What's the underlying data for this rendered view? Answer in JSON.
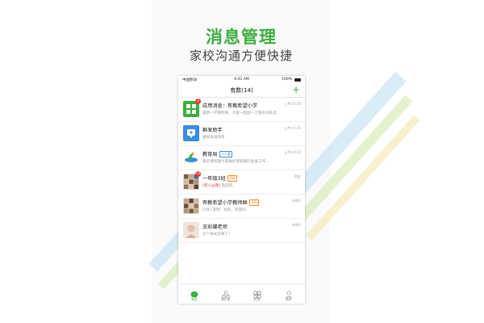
{
  "banner": {
    "headline": "消息管理",
    "subline": "家校沟通方便快捷"
  },
  "status_bar": {
    "carrier": "中国移动",
    "time": "9:41 AM",
    "battery": "100%"
  },
  "nav": {
    "title": "有数(14)",
    "add_label": "+"
  },
  "conversations": [
    {
      "name": "应用消息：有教希望小学",
      "preview": "最新一学期到来，大家一起给一江春水的私流",
      "time": "上午10:30",
      "badge": "2",
      "avatar": "app-grid-icon"
    },
    {
      "name": "群发助手",
      "preview": "通知发送简单",
      "time": "上午10:30",
      "badge": "",
      "avatar": "broadcast-icon"
    },
    {
      "name": "教育局",
      "tag": "人人通",
      "preview": "临近寒假期大家做好寒假期的准备工作...",
      "time": "上午10:30",
      "badge": "",
      "avatar": "education-logo"
    },
    {
      "name": "一年级3班",
      "tag": "班级",
      "mention": "[有人@我]",
      "preview": "再说吧。",
      "time": "周五",
      "badge": "15",
      "avatar": "class-group"
    },
    {
      "name": "有教希望小学教师群",
      "tag": "学校",
      "preview": "[5条] 李明：好的，知道的",
      "time": "昨晚5",
      "badge": "",
      "avatar": "teacher-group"
    },
    {
      "name": "王彩蝶老师",
      "preview": "这个格式太棒了！",
      "time": "昨晚5",
      "badge": "",
      "avatar": "teacher-photo"
    }
  ],
  "tabs": [
    {
      "label": "消息",
      "icon": "chat-bubble-icon",
      "active": true
    },
    {
      "label": "通讯录",
      "icon": "contacts-icon",
      "active": false
    },
    {
      "label": "应用",
      "icon": "apps-grid-icon",
      "active": false
    },
    {
      "label": "我的",
      "icon": "profile-icon",
      "active": false
    }
  ],
  "colors": {
    "brand_green": "#3dae3f",
    "badge_red": "#e53935",
    "tag_blue": "#3a8de0",
    "tag_orange": "#f08a24"
  }
}
